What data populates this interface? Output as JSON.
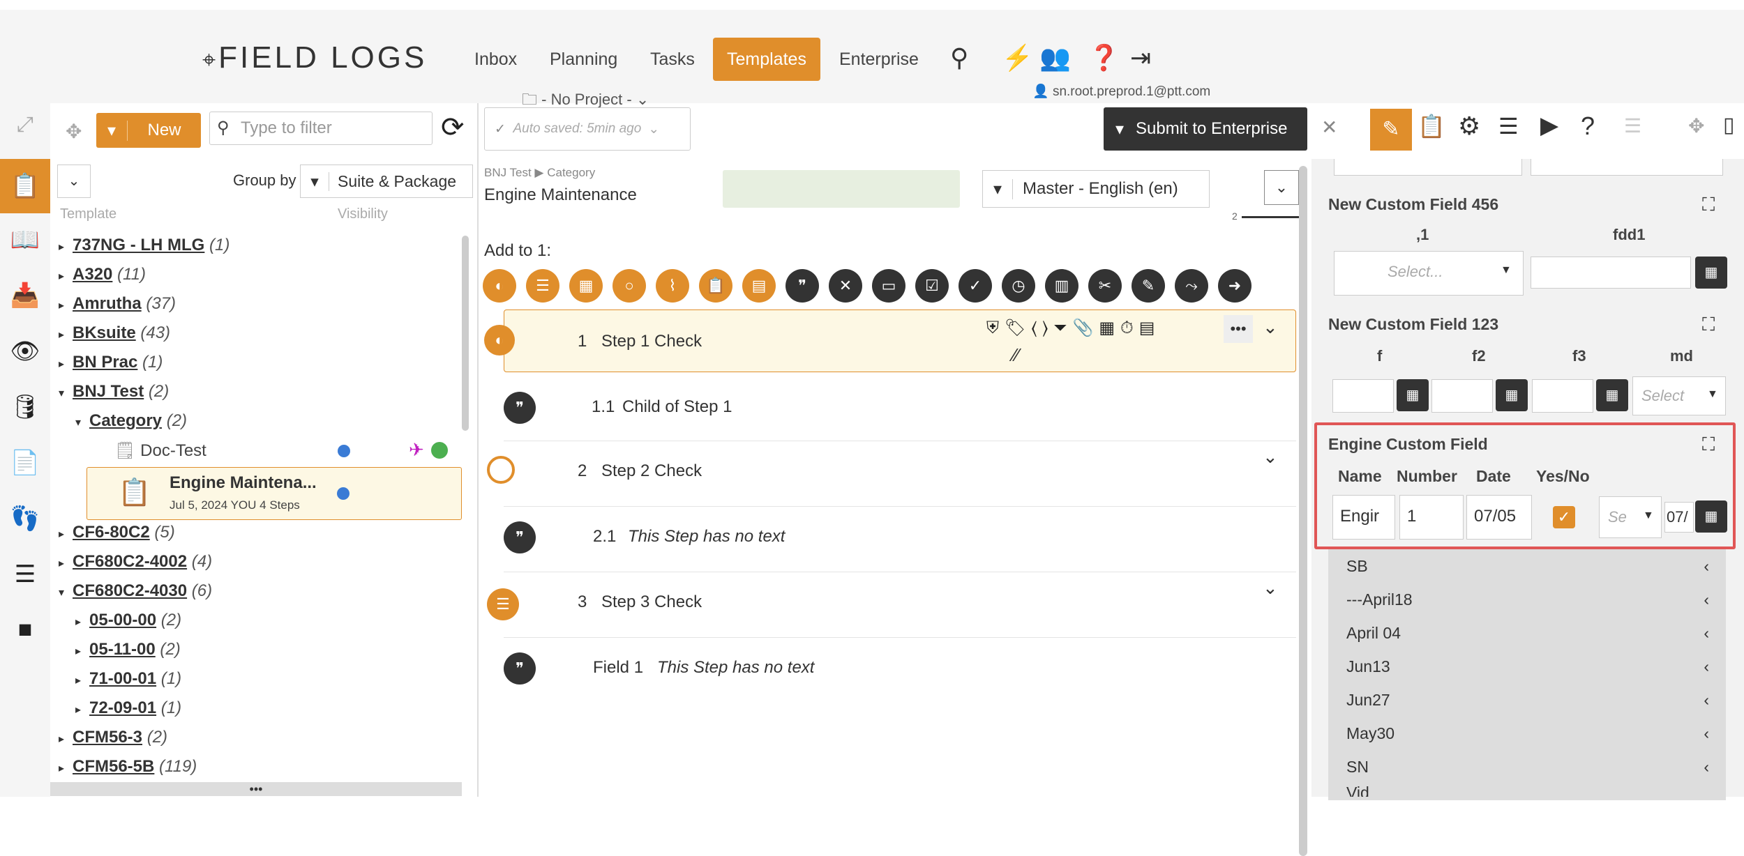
{
  "header": {
    "logo": "FIELD LOGS",
    "nav": [
      "Inbox",
      "Planning",
      "Tasks",
      "Templates",
      "Enterprise"
    ],
    "project": "- No Project -",
    "user": "sn.root.preprod.1@ptt.com"
  },
  "toolbar": {
    "new_label": "New",
    "filter_placeholder": "Type to filter",
    "group_by_label": "Group by",
    "group_by_value": "Suite & Package",
    "col_template": "Template",
    "col_visibility": "Visibility",
    "autosave": "Auto saved: 5min ago",
    "submit_label": "Submit to Enterprise"
  },
  "tree": [
    {
      "name": "737NG - LH MLG",
      "count": "(1)"
    },
    {
      "name": "A320",
      "count": "(11)"
    },
    {
      "name": "Amrutha",
      "count": "(37)"
    },
    {
      "name": "BKsuite",
      "count": "(43)"
    },
    {
      "name": "BN Prac",
      "count": "(1)"
    },
    {
      "name": "BNJ Test",
      "count": "(2)"
    },
    {
      "name": "Category",
      "count": "(2)"
    },
    {
      "name": "Doc-Test",
      "count": ""
    },
    {
      "name": "CF6-80C2",
      "count": "(5)"
    },
    {
      "name": "CF680C2-4002",
      "count": "(4)"
    },
    {
      "name": "CF680C2-4030",
      "count": "(6)"
    },
    {
      "name": "05-00-00",
      "count": "(2)"
    },
    {
      "name": "05-11-00",
      "count": "(2)"
    },
    {
      "name": "71-00-01",
      "count": "(1)"
    },
    {
      "name": "72-09-01",
      "count": "(1)"
    },
    {
      "name": "CFM56-3",
      "count": "(2)"
    },
    {
      "name": "CFM56-5B",
      "count": "(119)"
    }
  ],
  "selected_template": {
    "title": "Engine Maintena...",
    "meta": "Jul 5, 2024  YOU  4 Steps"
  },
  "editor": {
    "breadcrumb": "BNJ Test ▶ Category",
    "title": "Engine Maintenance",
    "language": "Master - English (en)",
    "page_indicator": "2",
    "add_to": "Add to 1:",
    "steps": [
      {
        "num": "1",
        "text": "Step 1 Check"
      },
      {
        "num": "1.1",
        "text": "Child of Step 1"
      },
      {
        "num": "2",
        "text": "Step 2 Check"
      },
      {
        "num": "2.1",
        "text": "This Step has no text"
      },
      {
        "num": "3",
        "text": "Step 3 Check"
      },
      {
        "num": "Field 1",
        "text": "This Step has no text"
      }
    ]
  },
  "right": {
    "cf456_title": "New Custom Field 456",
    "cf456_col1": ",1",
    "cf456_col2": "fdd1",
    "cf456_select": "Select...",
    "cf123_title": "New Custom Field 123",
    "cf123_cols": [
      "f",
      "f2",
      "f3",
      "md"
    ],
    "cf123_select": "Select",
    "engine_title": "Engine Custom Field",
    "engine_cols": [
      "Name",
      "Number",
      "Date",
      "Yes/No"
    ],
    "engine_name": "Engir",
    "engine_number": "1",
    "engine_date": "07/05",
    "engine_sel": "Se",
    "engine_date2": "07/",
    "list": [
      "SB",
      "---April18",
      "April 04",
      "Jun13",
      "Jun27",
      "May30",
      "SN",
      "Vid"
    ]
  }
}
